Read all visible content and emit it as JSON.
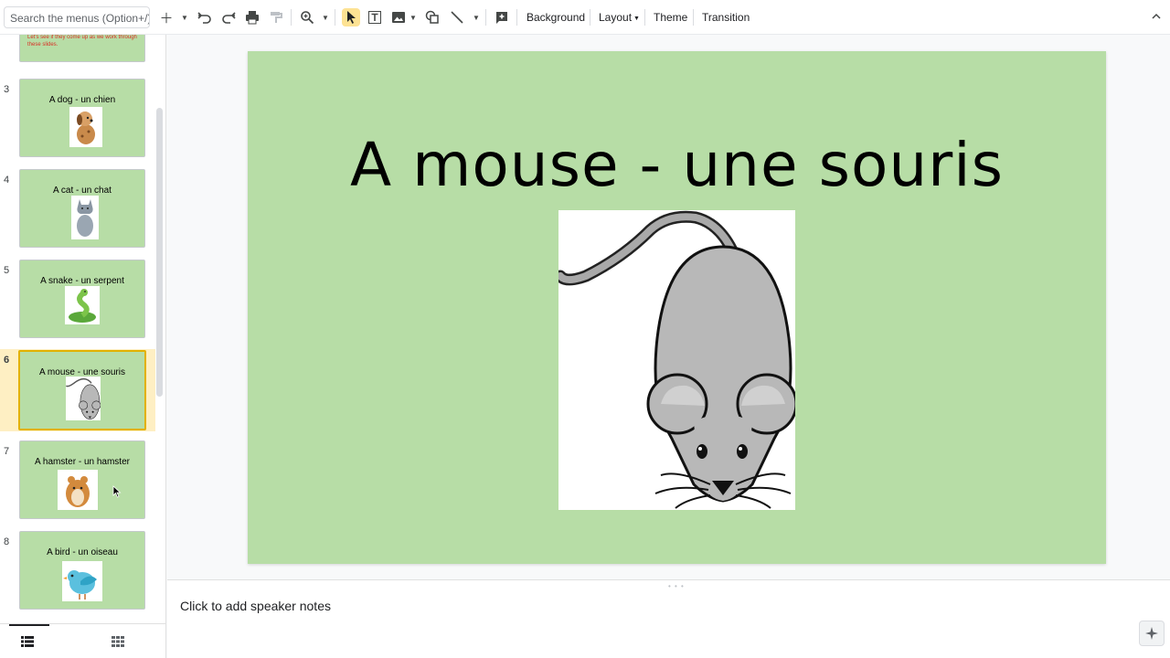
{
  "toolbar": {
    "search_placeholder": "Search the menus (Option+/)",
    "background_label": "Background",
    "layout_label": "Layout",
    "theme_label": "Theme",
    "transition_label": "Transition"
  },
  "filmstrip": {
    "partial_slide_text": "Let's see if they come up as we work through these slides.",
    "slides": [
      {
        "number": "3",
        "title": "A dog - un chien",
        "icon": "dog-image"
      },
      {
        "number": "4",
        "title": "A cat - un chat",
        "icon": "cat-image"
      },
      {
        "number": "5",
        "title": "A snake - un serpent",
        "icon": "snake-image"
      },
      {
        "number": "6",
        "title": "A mouse - une souris",
        "icon": "mouse-image",
        "selected": true
      },
      {
        "number": "7",
        "title": "A hamster - un hamster",
        "icon": "hamster-image"
      },
      {
        "number": "8",
        "title": "A bird - un oiseau",
        "icon": "bird-image"
      }
    ]
  },
  "current_slide": {
    "title": "A mouse - une souris",
    "image": "mouse-image",
    "background_color": "#b7dda6"
  },
  "notes": {
    "placeholder": "Click to add speaker notes"
  },
  "colors": {
    "slide_bg": "#b7dda6",
    "selection": "#e2b100",
    "selection_bg": "#feefc3"
  }
}
